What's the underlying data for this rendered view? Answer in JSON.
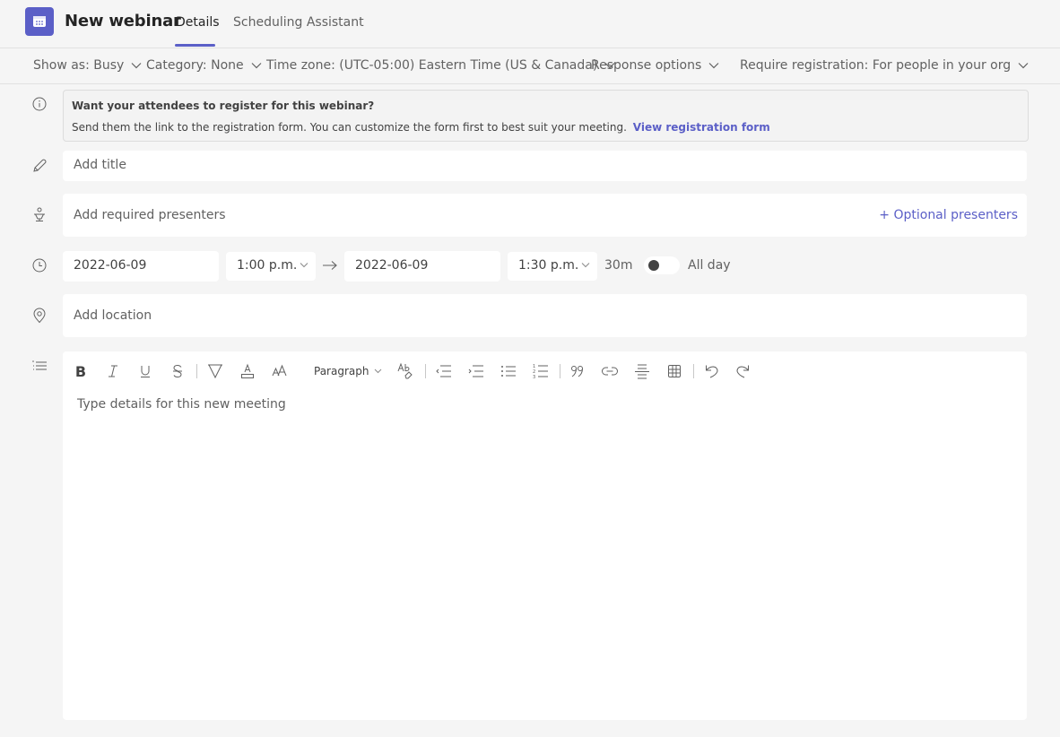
{
  "header": {
    "app_icon": "calendar-icon",
    "title": "New webinar",
    "tabs": [
      {
        "label": "Details",
        "active": true
      },
      {
        "label": "Scheduling Assistant",
        "active": false
      }
    ],
    "accent_color": "#5b5fc7"
  },
  "options_bar": {
    "show_as": "Show as: Busy",
    "category": "Category: None",
    "time_zone": "Time zone: (UTC-05:00) Eastern Time (US & Canada)",
    "response_options": "Response options",
    "require_registration": "Require registration: For people in your org"
  },
  "registration_banner": {
    "icon": "info-icon",
    "title": "Want your attendees to register for this webinar?",
    "body": "Send them the link to the registration form. You can customize the form first to best suit your meeting.",
    "link": "View registration form"
  },
  "form": {
    "title_placeholder": "Add title",
    "presenters_placeholder": "Add required presenters",
    "optional_presenters": "+ Optional presenters",
    "start_date": "2022-06-09",
    "start_time": "1:00 p.m.",
    "end_date": "2022-06-09",
    "end_time": "1:30 p.m.",
    "duration": "30m",
    "all_day_label": "All day",
    "all_day_on": false,
    "location_placeholder": "Add location"
  },
  "editor": {
    "toolbar": {
      "bold": "B",
      "italic": "I",
      "underline": "U",
      "strikethrough": "S",
      "paragraph": "Paragraph"
    },
    "placeholder": "Type details for this new meeting"
  }
}
